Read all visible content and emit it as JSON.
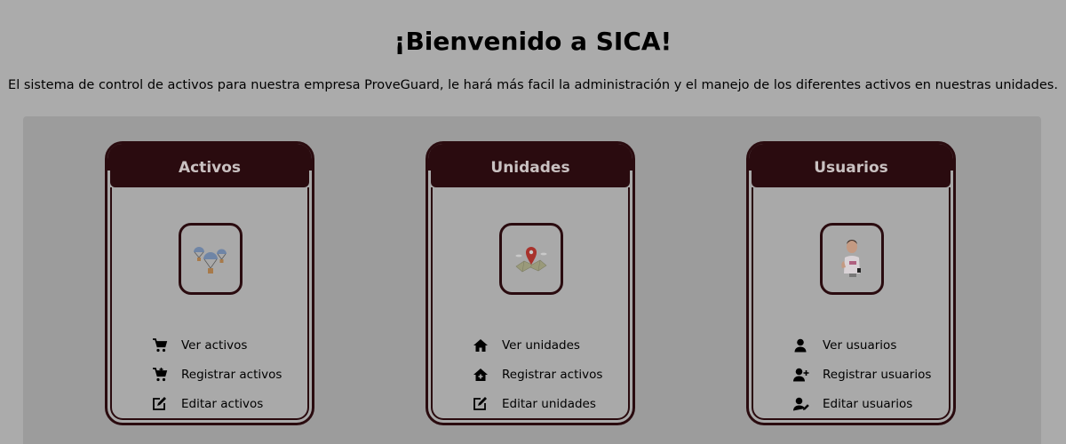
{
  "header": {
    "title": "¡Bienvenido a SICA!",
    "description": "El sistema de control de activos para nuestra empresa ProveGuard, le hará más facil la administración y el manejo de los diferentes activos en nuestras unidades."
  },
  "cards": [
    {
      "title": "Activos",
      "image_icon": "parachute-packages-icon",
      "links": [
        {
          "label": "Ver activos",
          "icon": "cart-icon"
        },
        {
          "label": "Registrar activos",
          "icon": "cart-plus-icon"
        },
        {
          "label": "Editar activos",
          "icon": "edit-icon"
        }
      ]
    },
    {
      "title": "Unidades",
      "image_icon": "map-pin-icon",
      "links": [
        {
          "label": "Ver unidades",
          "icon": "home-icon"
        },
        {
          "label": "Registrar activos",
          "icon": "home-plus-icon"
        },
        {
          "label": "Editar unidades",
          "icon": "edit-icon"
        }
      ]
    },
    {
      "title": "Usuarios",
      "image_icon": "user-avatar-icon",
      "links": [
        {
          "label": "Ver usuarios",
          "icon": "user-icon"
        },
        {
          "label": "Registrar usuarios",
          "icon": "user-plus-icon"
        },
        {
          "label": "Editar usuarios",
          "icon": "user-edit-icon"
        }
      ]
    }
  ],
  "colors": {
    "overlay_background": "#ababab",
    "panel": "#9c9c9c",
    "card_border": "#2a0b0f",
    "card_title_text": "#c9c1c1"
  }
}
